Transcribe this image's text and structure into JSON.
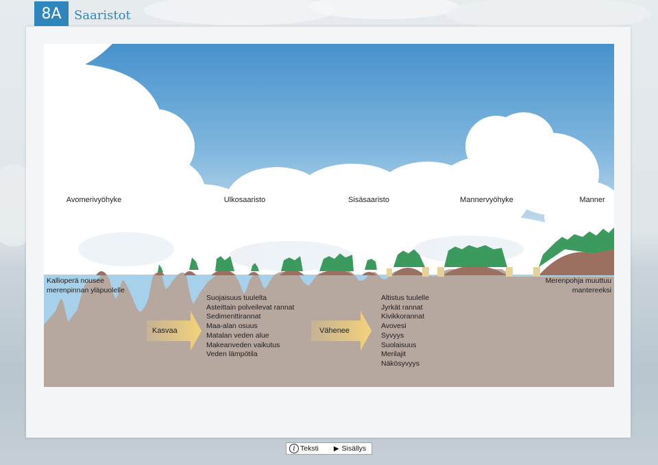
{
  "header": {
    "badge": "8A",
    "title": "Saaristot"
  },
  "zones": [
    {
      "id": "avomeri",
      "label": "Avomerivyöhyke"
    },
    {
      "id": "ulko",
      "label": "Ulkosaaristo"
    },
    {
      "id": "sisa",
      "label": "Sisäsaaristo"
    },
    {
      "id": "manner",
      "label": "Mannervyöhyke"
    },
    {
      "id": "mantere",
      "label": "Manner"
    }
  ],
  "left_note": [
    "Kallioperä nousee",
    "merenpinnan yläpuolelle"
  ],
  "right_note": [
    "Merenpohja muuttuu",
    "mantereeksi"
  ],
  "arrow_increase": "Kasvaa",
  "arrow_decrease": "Vähenee",
  "increase_list": [
    "Suojaisuus tuulelta",
    "Asteittain polveilevat rannat",
    "Sedimenttirannat",
    "Maa-alan osuus",
    "Matalan veden alue",
    "Makeanveden vaikutus",
    "Veden lämpötila"
  ],
  "decrease_list": [
    "Altistus tuulelle",
    "Jyrkät rannat",
    "Kivikkorannat",
    "Avovesi",
    "Syvyys",
    "Suolaisuus",
    "Merilajit",
    "Näkösyvyys"
  ],
  "footer": {
    "text_label": "Teksti",
    "contents_label": "Sisällys"
  },
  "colors": {
    "accent": "#2e86bd",
    "sky": "#4f9bd3",
    "water": "#a7d1ea",
    "rock": "#b6a79f",
    "soil": "#9b7060",
    "vegetation": "#3c9a5f",
    "arrow": "#f4d27a"
  }
}
